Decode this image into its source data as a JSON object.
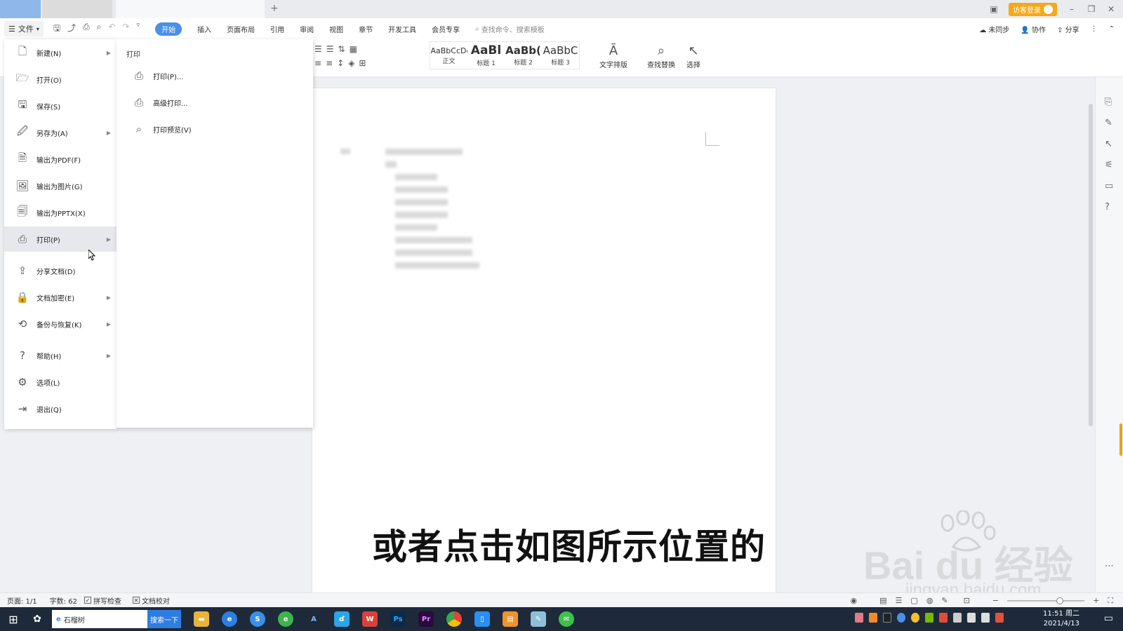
{
  "titlebar": {
    "visitor_login": "访客登录"
  },
  "menu": {
    "file_label": "文件",
    "tabs": [
      "开始",
      "插入",
      "页面布局",
      "引用",
      "审阅",
      "视图",
      "章节",
      "开发工具",
      "会员专享"
    ],
    "search_placeholder": "查找命令、搜索模板",
    "right": {
      "sync": "未同步",
      "collab": "协作",
      "share": "分享"
    }
  },
  "ribbon": {
    "styles": [
      {
        "sample": "AaBbCcDc",
        "label": "正文"
      },
      {
        "sample": "AaBl",
        "label": "标题 1"
      },
      {
        "sample": "AaBb(",
        "label": "标题 2"
      },
      {
        "sample": "AaBbC",
        "label": "标题 3"
      }
    ],
    "text_layout": "文字排版",
    "find_replace": "查找替换",
    "select": "选择"
  },
  "file_menu": {
    "items": [
      {
        "label": "新建(N)",
        "icon": "new-doc-icon",
        "arrow": true
      },
      {
        "label": "打开(O)",
        "icon": "folder-icon",
        "arrow": false
      },
      {
        "label": "保存(S)",
        "icon": "save-icon",
        "arrow": false
      },
      {
        "label": "另存为(A)",
        "icon": "save-as-icon",
        "arrow": true
      },
      {
        "label": "输出为PDF(F)",
        "icon": "pdf-icon",
        "arrow": false
      },
      {
        "label": "输出为图片(G)",
        "icon": "image-icon",
        "arrow": false
      },
      {
        "label": "输出为PPTX(X)",
        "icon": "pptx-icon",
        "arrow": false
      },
      {
        "label": "打印(P)",
        "icon": "printer-icon",
        "arrow": true,
        "hover": true
      },
      {
        "label": "分享文档(D)",
        "icon": "share-icon",
        "arrow": false
      },
      {
        "label": "文档加密(E)",
        "icon": "lock-doc-icon",
        "arrow": true
      },
      {
        "label": "备份与恢复(K)",
        "icon": "backup-icon",
        "arrow": true
      },
      {
        "label": "帮助(H)",
        "icon": "help-icon",
        "arrow": true
      },
      {
        "label": "选项(L)",
        "icon": "gear-icon",
        "arrow": false
      },
      {
        "label": "退出(Q)",
        "icon": "exit-icon",
        "arrow": false
      }
    ]
  },
  "print_submenu": {
    "title": "打印",
    "items": [
      {
        "label": "打印(P)...",
        "icon": "printer-icon"
      },
      {
        "label": "高级打印...",
        "icon": "advanced-print-icon"
      },
      {
        "label": "打印预览(V)",
        "icon": "print-preview-icon"
      }
    ]
  },
  "caption": "或者点击如图所示位置的",
  "watermark": {
    "logo": "Bai du 经验",
    "url": "jingyan.baidu.com"
  },
  "statusbar": {
    "page": "页面: 1/1",
    "words": "字数: 62",
    "spell_check": "拼写检查",
    "doc_proof": "文档校对"
  },
  "taskbar": {
    "search_text": "石榴树",
    "search_button": "搜索一下",
    "time": "11:51 周二",
    "date": "2021/4/13"
  },
  "colors": {
    "accent": "#4a90e8",
    "visitor_button": "#f4a81b",
    "taskbar": "#1e2a3a"
  }
}
